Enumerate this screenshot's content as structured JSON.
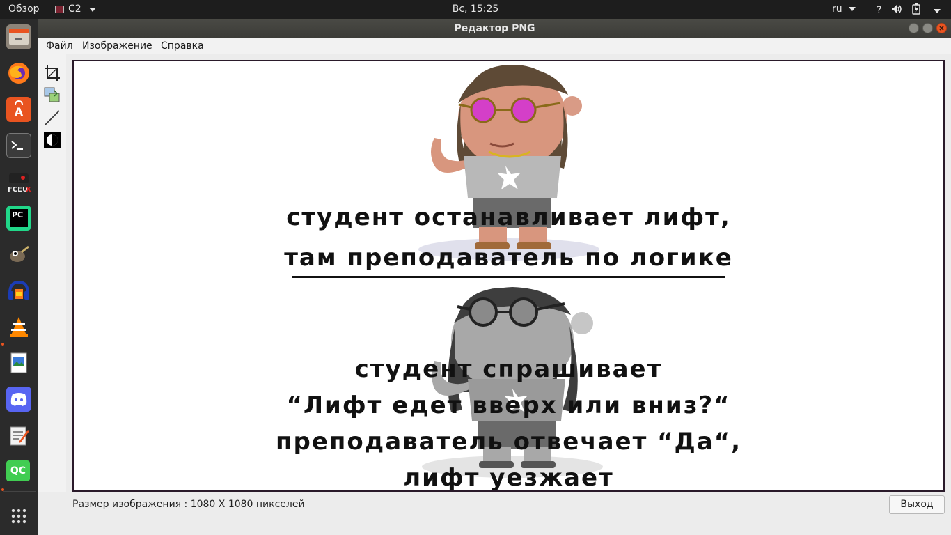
{
  "topbar": {
    "overview": "Обзор",
    "app": "C2",
    "clock": "Вс, 15:25",
    "lang": "ru",
    "icons": [
      "help-icon",
      "volume-icon",
      "battery-icon",
      "system-menu-caret-icon"
    ]
  },
  "dock": {
    "items": [
      "files-icon",
      "firefox-icon",
      "software-center-icon",
      "terminal-icon",
      "fceux-icon",
      "pycharm-icon",
      "gimp-icon",
      "audacity-icon",
      "vlc-icon",
      "image-viewer-icon",
      "discord-icon",
      "text-editor-icon",
      "qc-icon",
      "show-apps-icon"
    ],
    "qc_label": "QC",
    "pc_label": "PC"
  },
  "window": {
    "title": "Редактор PNG"
  },
  "menu": {
    "file": "Файл",
    "image": "Изображение",
    "help": "Справка"
  },
  "tools": [
    "crop-icon",
    "layers-icon",
    "line-icon",
    "invert-icon"
  ],
  "meme": {
    "top_lines": [
      "студент останавливает лифт,",
      "там преподаватель по логике"
    ],
    "bottom_lines": [
      "студент спрашивает",
      "“Лифт едет вверх или вниз?“",
      "преподаватель отвечает “Да“,",
      "лифт уезжает"
    ]
  },
  "status": {
    "size_text": "Размер изображения : 1080 X 1080 пикселей",
    "exit_label": "Выход"
  },
  "colors": {
    "topbar": "#1d1d1d",
    "dock": "#2b2b2b",
    "accent": "#e95420",
    "glasses_top": "#d43fc8"
  }
}
